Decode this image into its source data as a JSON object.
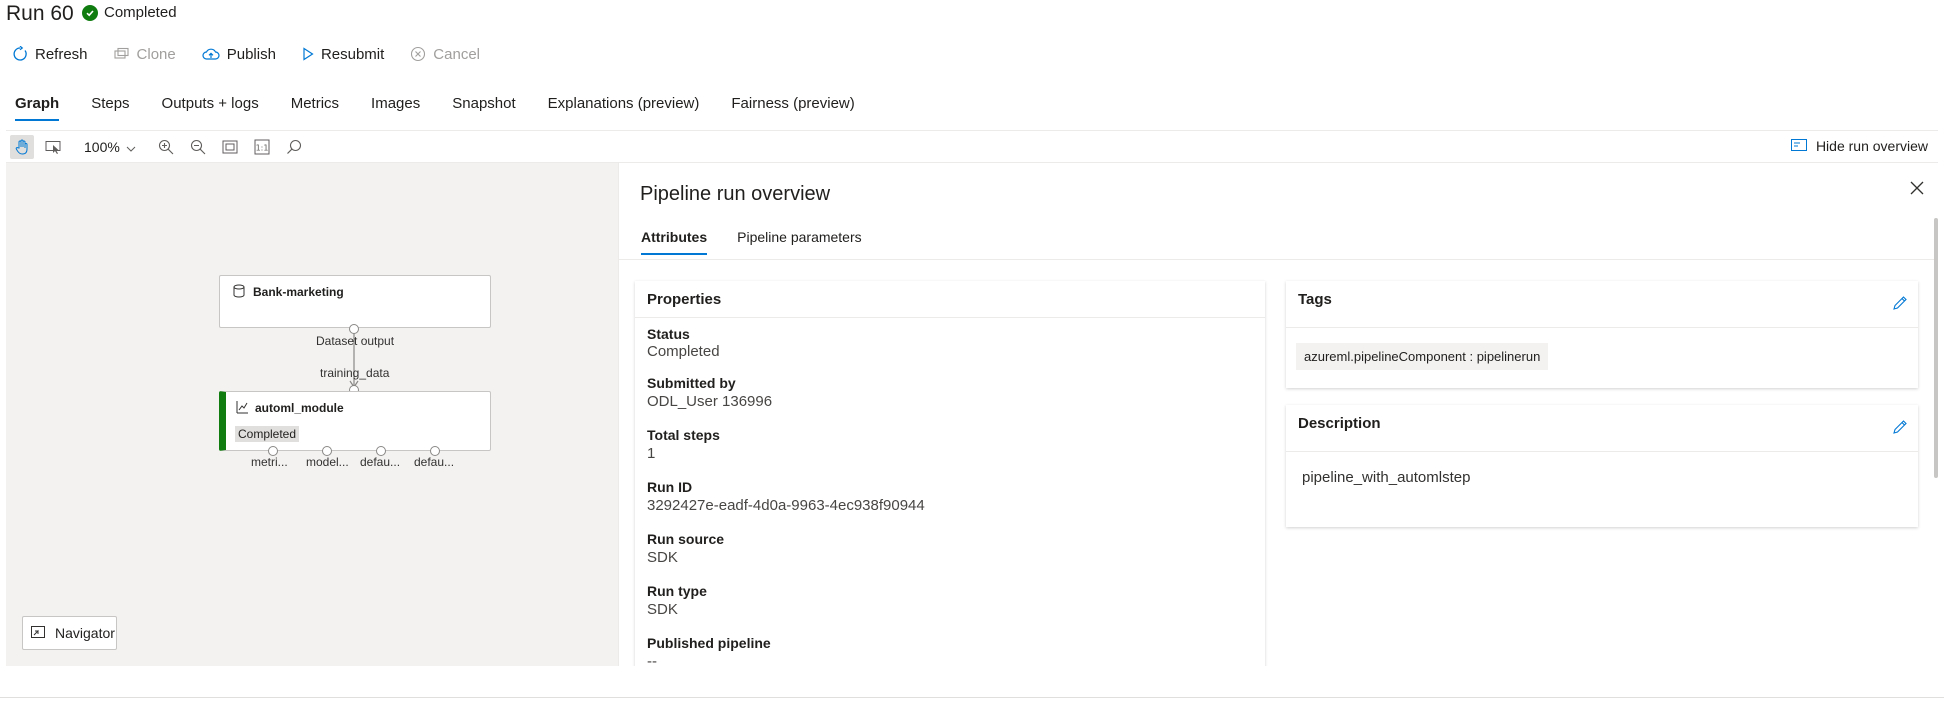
{
  "header": {
    "title": "Run 60",
    "status": "Completed",
    "status_color": "#107c10"
  },
  "commands": {
    "refresh": "Refresh",
    "clone": "Clone",
    "publish": "Publish",
    "resubmit": "Resubmit",
    "cancel": "Cancel"
  },
  "tabs": [
    "Graph",
    "Steps",
    "Outputs + logs",
    "Metrics",
    "Images",
    "Snapshot",
    "Explanations (preview)",
    "Fairness (preview)"
  ],
  "toolbar": {
    "zoom": "100%",
    "hide_overview": "Hide run overview"
  },
  "graph": {
    "dataset_node": {
      "title": "Bank-marketing",
      "output_label": "Dataset output"
    },
    "edge_label": "training_data",
    "automl_node": {
      "title": "automl_module",
      "status": "Completed",
      "status_color": "#107c10",
      "outputs": [
        "metri...",
        "model...",
        "defau...",
        "defau..."
      ]
    },
    "navigator": "Navigator"
  },
  "panel": {
    "title": "Pipeline run overview",
    "tabs": [
      "Attributes",
      "Pipeline parameters"
    ],
    "properties": {
      "title": "Properties",
      "items": [
        {
          "label": "Status",
          "value": "Completed"
        },
        {
          "label": "Submitted by",
          "value": "ODL_User 136996"
        },
        {
          "label": "Total steps",
          "value": "1"
        },
        {
          "label": "Run ID",
          "value": "3292427e-eadf-4d0a-9963-4ec938f90944"
        },
        {
          "label": "Run source",
          "value": "SDK"
        },
        {
          "label": "Run type",
          "value": "SDK"
        },
        {
          "label": "Published pipeline",
          "value": "--"
        }
      ]
    },
    "tags": {
      "title": "Tags",
      "items": [
        "azureml.pipelineComponent : pipelinerun"
      ]
    },
    "description": {
      "title": "Description",
      "text": "pipeline_with_automlstep"
    }
  },
  "colors": {
    "accent": "#0078d4",
    "success": "#107c10"
  }
}
